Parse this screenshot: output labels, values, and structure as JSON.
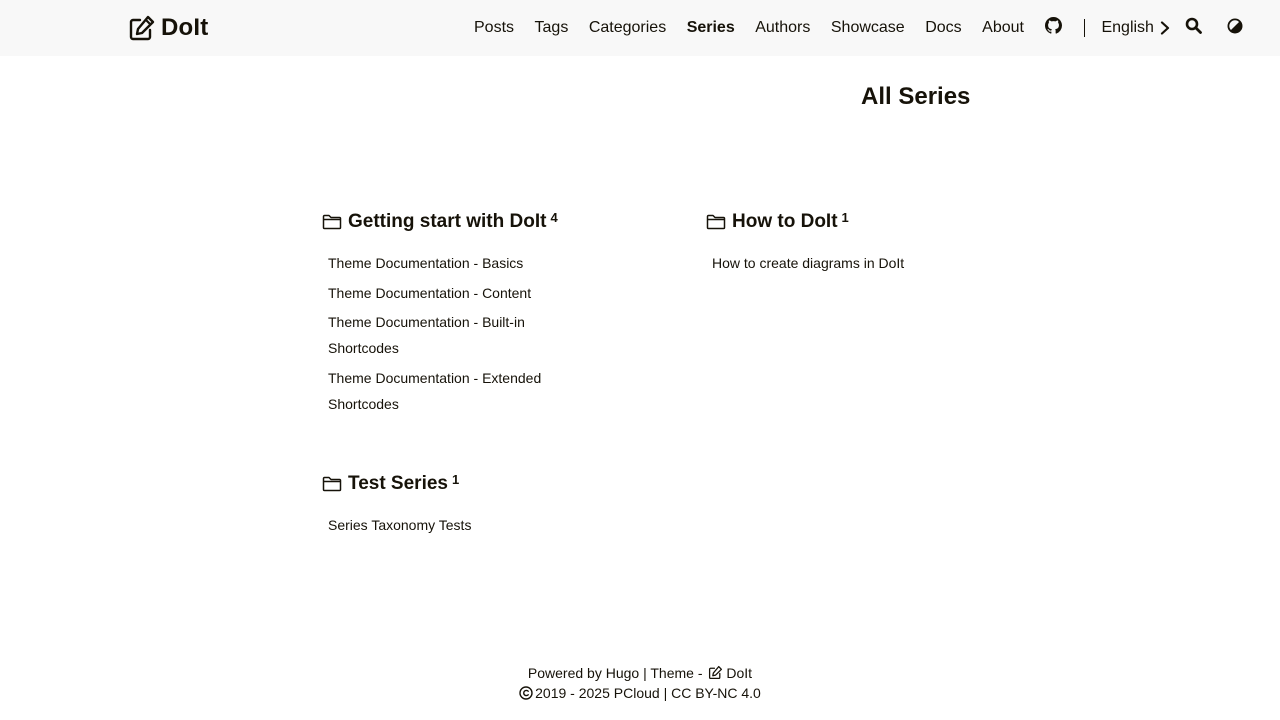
{
  "header": {
    "site_title": "DoIt",
    "nav": [
      {
        "label": "Posts",
        "active": false
      },
      {
        "label": "Tags",
        "active": false
      },
      {
        "label": "Categories",
        "active": false
      },
      {
        "label": "Series",
        "active": true
      },
      {
        "label": "Authors",
        "active": false
      },
      {
        "label": "Showcase",
        "active": false
      },
      {
        "label": "Docs",
        "active": false
      },
      {
        "label": "About",
        "active": false
      }
    ],
    "language": "English",
    "icons": [
      "edit-logo-icon",
      "github-icon",
      "chevron-right-icon",
      "search-icon",
      "theme-toggle-icon"
    ]
  },
  "main": {
    "title": "All Series",
    "series": [
      {
        "name": "Getting start with DoIt",
        "count": "4",
        "posts": [
          "Theme Documentation - Basics",
          "Theme Documentation - Content",
          "Theme Documentation - Built-in Shortcodes",
          "Theme Documentation - Extended Shortcodes"
        ]
      },
      {
        "name": "How to DoIt",
        "count": "1",
        "posts": [
          "How to create diagrams in DoIt"
        ]
      },
      {
        "name": "Test Series",
        "count": "1",
        "posts": [
          "Series Taxonomy Tests"
        ]
      }
    ]
  },
  "footer": {
    "powered_prefix": "Powered by ",
    "hugo": "Hugo",
    "theme_sep": " | Theme - ",
    "theme_name": "DoIt",
    "copyright": "2019 - 2025 PCloud | CC BY-NC 4.0"
  }
}
